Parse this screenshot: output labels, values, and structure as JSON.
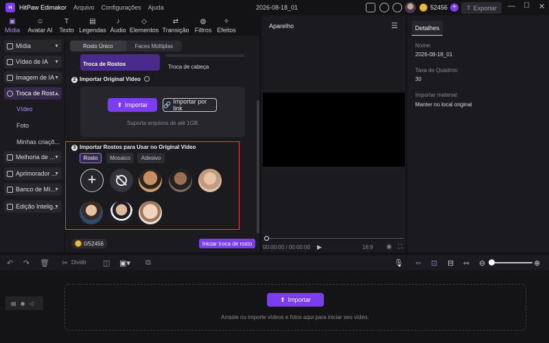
{
  "titlebar": {
    "logo": "H",
    "app_name": "HitPaw Edimakor",
    "menus": [
      "Arquivo",
      "Configurações",
      "Ajuda"
    ],
    "project_title": "2026-08-18_01",
    "credits": "52456",
    "export_label": "Exportar"
  },
  "tabs": [
    {
      "label": "Mídia",
      "icon": "media-icon"
    },
    {
      "label": "Avatar AI",
      "icon": "avatar-icon"
    },
    {
      "label": "Texto",
      "icon": "text-icon"
    },
    {
      "label": "Legendas",
      "icon": "subtitle-icon"
    },
    {
      "label": "Áudio",
      "icon": "audio-icon"
    },
    {
      "label": "Elementos",
      "icon": "elements-icon"
    },
    {
      "label": "Transição",
      "icon": "transition-icon"
    },
    {
      "label": "Filtros",
      "icon": "filter-icon"
    },
    {
      "label": "Efeitos",
      "icon": "effects-icon"
    }
  ],
  "sidebar": {
    "items": [
      {
        "label": "Mídia"
      },
      {
        "label": "Vídeo de IA"
      },
      {
        "label": "Imagem de IA"
      },
      {
        "label": "Troca de Rost..."
      },
      {
        "label": "Melhoria de ..."
      },
      {
        "label": "Aprimorador ..."
      },
      {
        "label": "Banco de Mí..."
      },
      {
        "label": "Edição Intelig..."
      }
    ],
    "subitems": [
      "Vídeo",
      "Foto",
      "Minhas criaçõ..."
    ]
  },
  "main": {
    "mode_tabs": [
      "Rosto Único",
      "Faces Múltiplas"
    ],
    "face_types": [
      "Troca de Rostos",
      "Troca de cabeça"
    ],
    "step2_num": "2",
    "step2_title": "Importar Original Vídeo",
    "import_label": "Importar",
    "import_link_label": "Importar por link",
    "import_hint": "Suporta arquivos de até 1GB",
    "step3_num": "3",
    "step3_title": "Importar Rostos para Usar no Original Vídeo",
    "face_chips": [
      "Rosto",
      "Mosaico",
      "Adesivo"
    ],
    "credits_cost": "0/52456",
    "start_label": "Iniciar troca de rosto"
  },
  "preview": {
    "title": "Aparelho",
    "time": "00:00:00 / 00:00:00",
    "aspect": "16:9"
  },
  "details": {
    "tab": "Detalhes",
    "name_label": "Nome:",
    "name_value": "2026-08-18_01",
    "fps_label": "Taxa de Quadros:",
    "fps_value": "30",
    "import_label": "Importar material:",
    "import_value": "Manter no local original"
  },
  "timeline": {
    "split_label": "Dividir",
    "import_label": "Importar",
    "drop_hint": "Arraste ou importe vídeos e fotos aqui para iniciar seu vídeo."
  }
}
